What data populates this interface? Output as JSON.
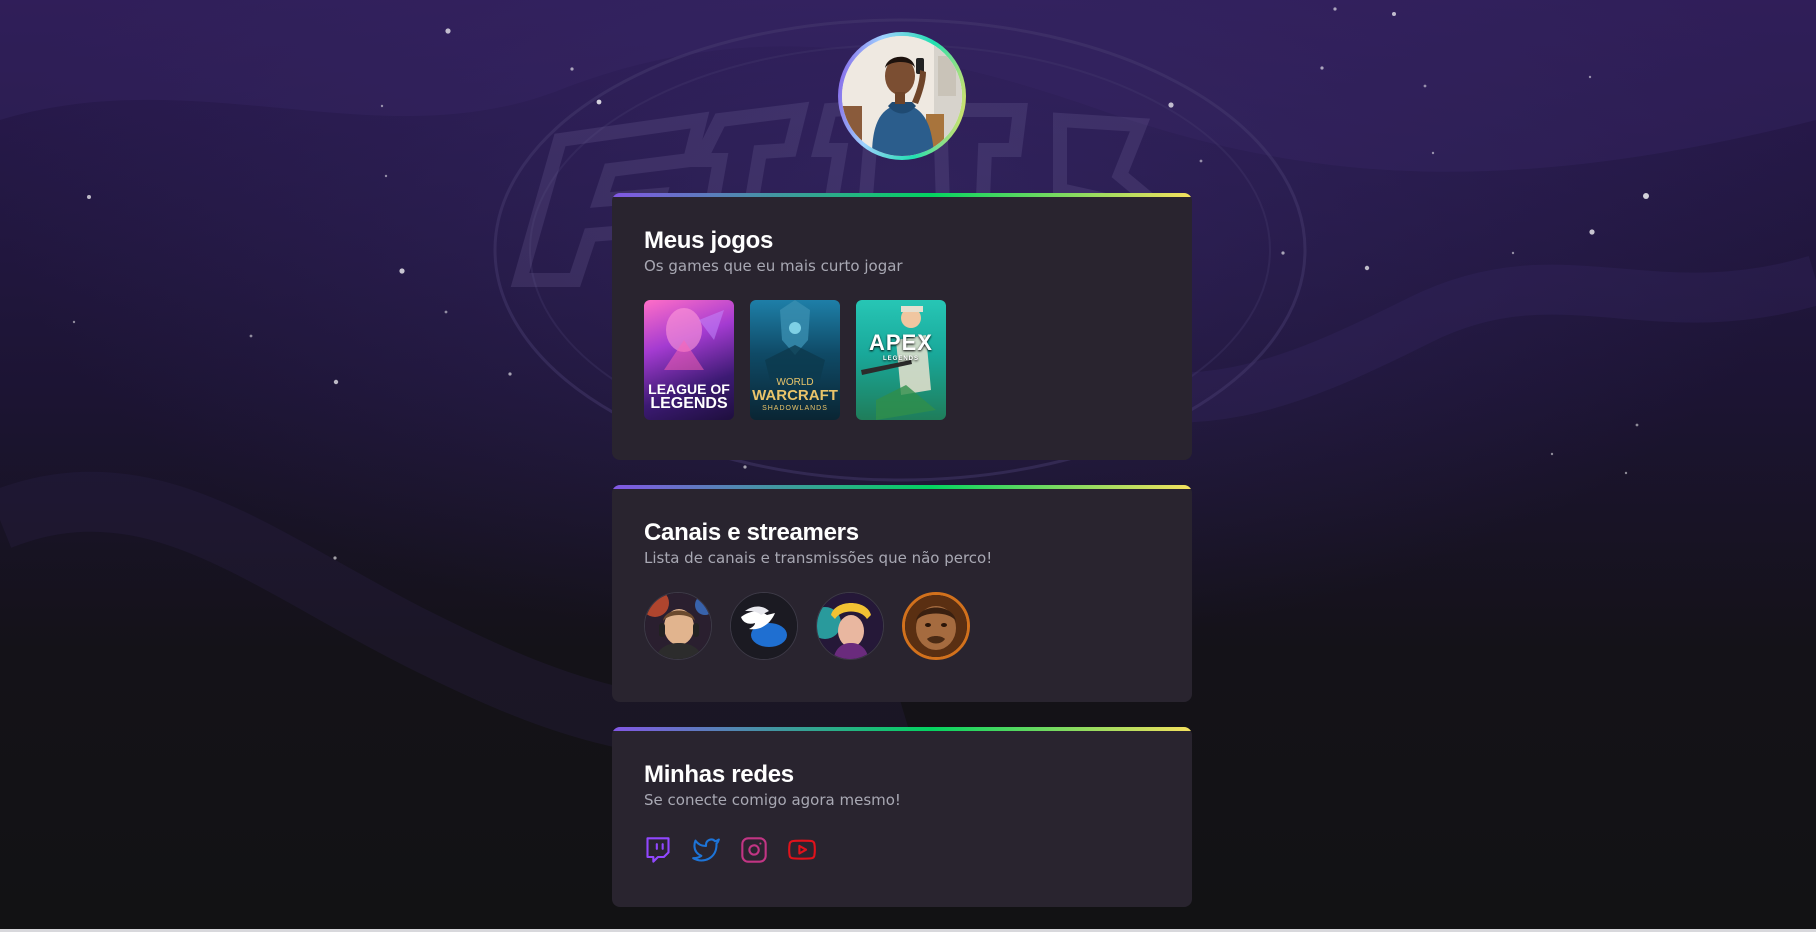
{
  "profile": {
    "avatar_alt": "Foto de perfil"
  },
  "games_card": {
    "title": "Meus jogos",
    "subtitle": "Os games que eu mais curto jogar",
    "games": [
      {
        "name": "League of Legends",
        "label_line1": "LEAGUE OF",
        "label_line2": "LEGENDS"
      },
      {
        "name": "World of Warcraft Shadowlands",
        "label_line1": "WORLD",
        "label_line2": "WARCRAFT",
        "label_line3": "SHADOWLANDS"
      },
      {
        "name": "Apex Legends",
        "label_line1": "APEX",
        "label_line2": "LEGENDS"
      }
    ]
  },
  "streamers_card": {
    "title": "Canais e streamers",
    "subtitle": "Lista de canais e transmissões que não perco!"
  },
  "socials_card": {
    "title": "Minhas redes",
    "subtitle": "Se conecte comigo agora mesmo!",
    "links": [
      {
        "icon": "twitch-icon",
        "color": "#9147ff"
      },
      {
        "icon": "twitter-icon",
        "color": "#1d74d8"
      },
      {
        "icon": "instagram-icon",
        "color": "#c13584"
      },
      {
        "icon": "youtube-icon",
        "color": "#e0121b"
      }
    ]
  },
  "colors": {
    "card_bg": "#29242f",
    "accent_gradient": [
      "#8257e5",
      "#04d361",
      "#f5e15e"
    ],
    "title": "#ffffff",
    "subtitle": "#a8a8b3"
  }
}
